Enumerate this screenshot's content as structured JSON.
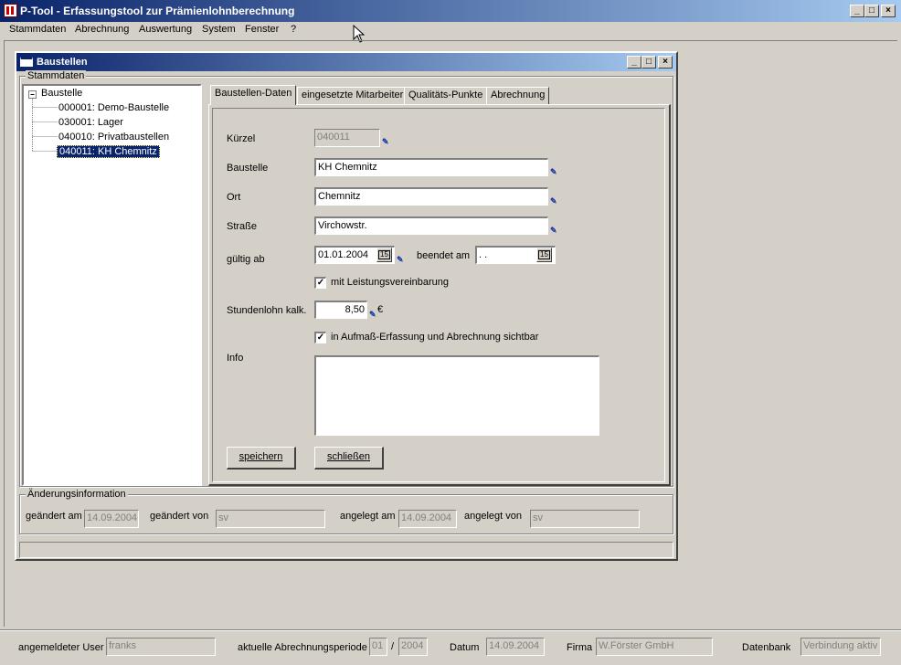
{
  "app": {
    "title": "P-Tool - Erfassungstool zur Prämienlohnberechnung",
    "minimize": "_",
    "maximize": "□",
    "close": "×"
  },
  "menu": [
    "Stammdaten",
    "Abrechnung",
    "Auswertung",
    "System",
    "Fenster",
    "?"
  ],
  "child": {
    "title": "Baustellen",
    "group_label": "Stammdaten",
    "tree": {
      "root": "Baustelle",
      "items": [
        "000001: Demo-Baustelle",
        "030001: Lager",
        "040010: Privatbaustellen",
        "040011: KH Chemnitz"
      ]
    },
    "tabs": [
      "Baustellen-Daten",
      "eingesetzte Mitarbeiter",
      "Qualitäts-Punkte",
      "Abrechnung"
    ],
    "form": {
      "kuerzel_label": "Kürzel",
      "kuerzel_value": "040011",
      "baustelle_label": "Baustelle",
      "baustelle_value": "KH Chemnitz",
      "ort_label": "Ort",
      "ort_value": "Chemnitz",
      "strasse_label": "Straße",
      "strasse_value": "Virchowstr.",
      "gueltig_label": "gültig ab",
      "gueltig_value": "01.01.2004",
      "beendet_label": "beendet am",
      "beendet_value": "  .  .",
      "cal_glyph": "15",
      "leistung_label": "mit Leistungsvereinbarung",
      "leistung_checked": true,
      "stundenlohn_label": "Stundenlohn kalk.",
      "stundenlohn_value": "8,50",
      "currency": "€",
      "sichtbar_label": "in Aufmaß-Erfassung und Abrechnung sichtbar",
      "sichtbar_checked": true,
      "info_label": "Info",
      "info_value": "",
      "save_button": "speichern",
      "close_button": "schließen"
    },
    "changes": {
      "group_label": "Änderungsinformation",
      "geaendert_am_label": "geändert am",
      "geaendert_am_value": "14.09.2004",
      "geaendert_von_label": "geändert von",
      "geaendert_von_value": "sv",
      "angelegt_am_label": "angelegt am",
      "angelegt_am_value": "14.09.2004",
      "angelegt_von_label": "angelegt von",
      "angelegt_von_value": "sv"
    }
  },
  "status": {
    "user_label": "angemeldeter User",
    "user_value": "franks",
    "period_label": "aktuelle Abrechnungsperiode",
    "period_month": "01",
    "period_sep": "/",
    "period_year": "2004",
    "datum_label": "Datum",
    "datum_value": "14.09.2004",
    "firma_label": "Firma",
    "firma_value": "W.Förster GmbH",
    "db_label": "Datenbank",
    "db_value": "Verbindung aktiv"
  }
}
